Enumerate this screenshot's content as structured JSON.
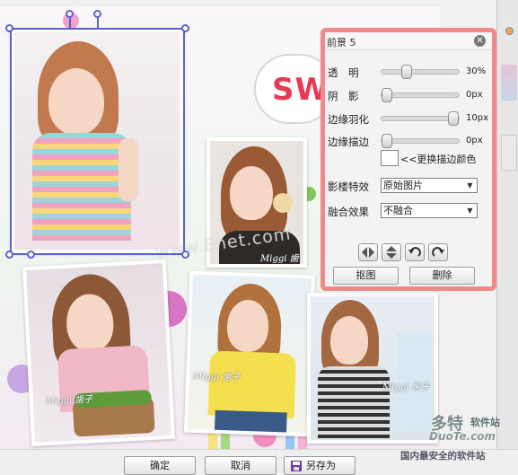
{
  "canvas": {
    "bubble_text": "SWE",
    "watermark": "www.Enet.com",
    "photo_signatures": [
      "Miggi 歯子",
      "Miggi 歯子",
      "Miggi 歯子",
      "Miggi 歯子"
    ]
  },
  "panel": {
    "title": "前景 5",
    "opacity_label": "透　明",
    "opacity_value": "30%",
    "opacity_level": 0.3,
    "shadow_label": "阴　影",
    "shadow_value": "0px",
    "shadow_level": 0.0,
    "feather_label": "边缘羽化",
    "feather_value": "10px",
    "feather_level": 1.0,
    "stroke_label": "边缘描边",
    "stroke_value": "0px",
    "stroke_level": 0.0,
    "change_color_label": "<<更换描边颜色",
    "stroke_color": "#ffffff",
    "effect_label": "影楼特效",
    "effect_selected": "原始图片",
    "blend_label": "融合效果",
    "blend_selected": "不融合",
    "matting_button": "抠图",
    "delete_button": "删除"
  },
  "footer": {
    "ok_button": "确定",
    "cancel_button": "取消",
    "save_as_button": "另存为"
  },
  "site_logo": {
    "big": "多特",
    "cn": "软件站",
    "url": "DuoTe.com",
    "slogan": "国内最安全的软件站"
  },
  "colors": {
    "panel_border": "#f08a8a",
    "selection": "#5a62c8",
    "bubble_text": "#e43a55"
  },
  "icons": [
    "close-icon",
    "flip-horizontal-icon",
    "flip-vertical-icon",
    "rotate-left-icon",
    "rotate-right-icon",
    "floppy-disk-icon",
    "select-dropdown-arrow-icon"
  ]
}
